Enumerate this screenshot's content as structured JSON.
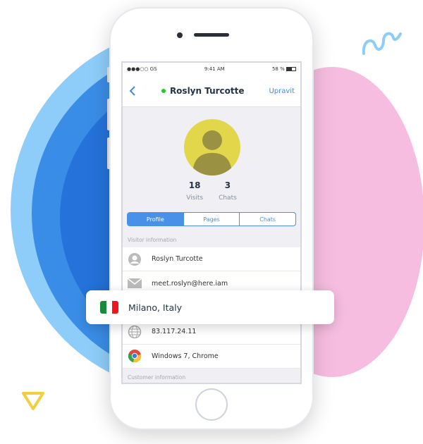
{
  "status_bar": {
    "carrier": "●●●○○ GS",
    "time": "9:41 AM",
    "battery": "58 %"
  },
  "nav": {
    "back_icon": "chevron-left-icon",
    "title": "Roslyn Turcotte",
    "online_color": "#1fcc26",
    "edit_label": "Upravit"
  },
  "stats": [
    {
      "value": "18",
      "label": "Visits"
    },
    {
      "value": "3",
      "label": "Chats"
    }
  ],
  "tabs": [
    {
      "label": "Profile",
      "active": true
    },
    {
      "label": "Pages"
    },
    {
      "label": "Chats"
    }
  ],
  "sections": {
    "visitor": "Visitor information",
    "customer": "Customer information"
  },
  "rows": [
    {
      "icon": "user-icon",
      "text": "Roslyn Turcotte"
    },
    {
      "icon": "mail-icon",
      "text": "meet.roslyn@here.iam"
    },
    {
      "icon": "globe-icon",
      "text": "83.117.24.11"
    },
    {
      "icon": "chrome-icon",
      "text": "Windows 7, Chrome"
    }
  ],
  "location_card": {
    "icon": "italy-flag-icon",
    "text": "Milano, Italy"
  },
  "colors": {
    "accent": "#4990e8",
    "avatar": "#e2d64a",
    "pink": "#f7bde0",
    "blue": "#2472da"
  }
}
